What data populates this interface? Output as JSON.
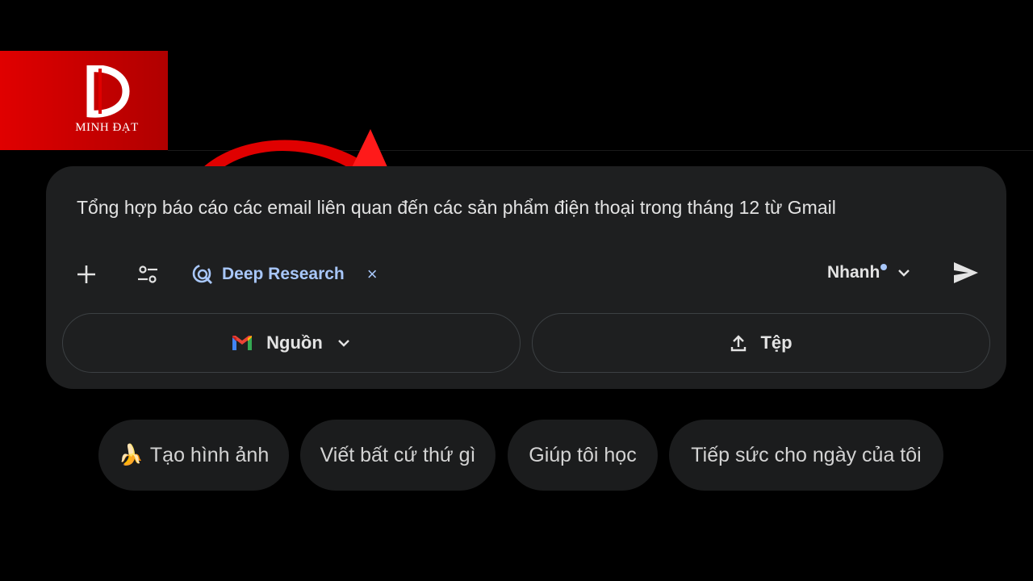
{
  "brand": {
    "name": "MINH ĐẠT",
    "logo_icon": "minh-dat-d-logo",
    "bg_color": "#e00000"
  },
  "composer": {
    "prompt_text": "Tổng hợp báo cáo các email liên quan đến các sản phẩm điện thoại trong tháng 12 từ Gmail",
    "tools": {
      "add_icon": "plus-icon",
      "tools_icon": "tune-icon",
      "deep_research_icon": "deep-research-icon",
      "deep_research_label": "Deep Research",
      "deep_research_close": "×",
      "mode_label": "Nhanh",
      "mode_icon": "chevron-down-icon",
      "send_icon": "send-icon"
    },
    "sources_button": {
      "label": "Nguồn",
      "icon": "gmail-icon"
    },
    "file_button": {
      "label": "Tệp",
      "icon": "upload-icon"
    },
    "accent_color": "#a8c7fa"
  },
  "suggestions": [
    {
      "label": "Tạo hình ảnh",
      "emoji": "🍌"
    },
    {
      "label": "Viết bất cứ thứ gì"
    },
    {
      "label": "Giúp tôi học"
    },
    {
      "label": "Tiếp sức cho ngày của tôi"
    }
  ],
  "annotation": {
    "icon": "red-arrow-icon",
    "color": "#e00000"
  }
}
